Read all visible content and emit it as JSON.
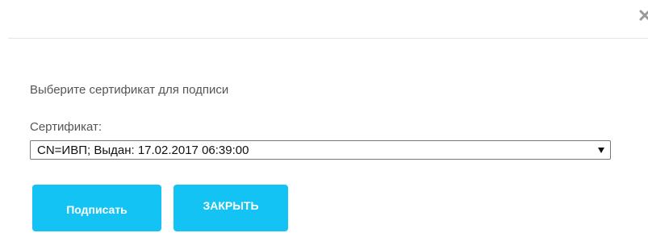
{
  "dialog": {
    "close_icon": "close-x-icon",
    "prompt": "Выберите сертификат для подписи",
    "certificate": {
      "label": "Сертификат:",
      "selected": "CN=ИВП; Выдан: 17.02.2017 06:39:00"
    },
    "buttons": {
      "sign": "Подписать",
      "close": "ЗАКРЫТЬ"
    }
  },
  "colors": {
    "accent": "#13c3f3",
    "text": "#555555",
    "divider": "#e5e5e5",
    "close_icon": "#999999"
  }
}
